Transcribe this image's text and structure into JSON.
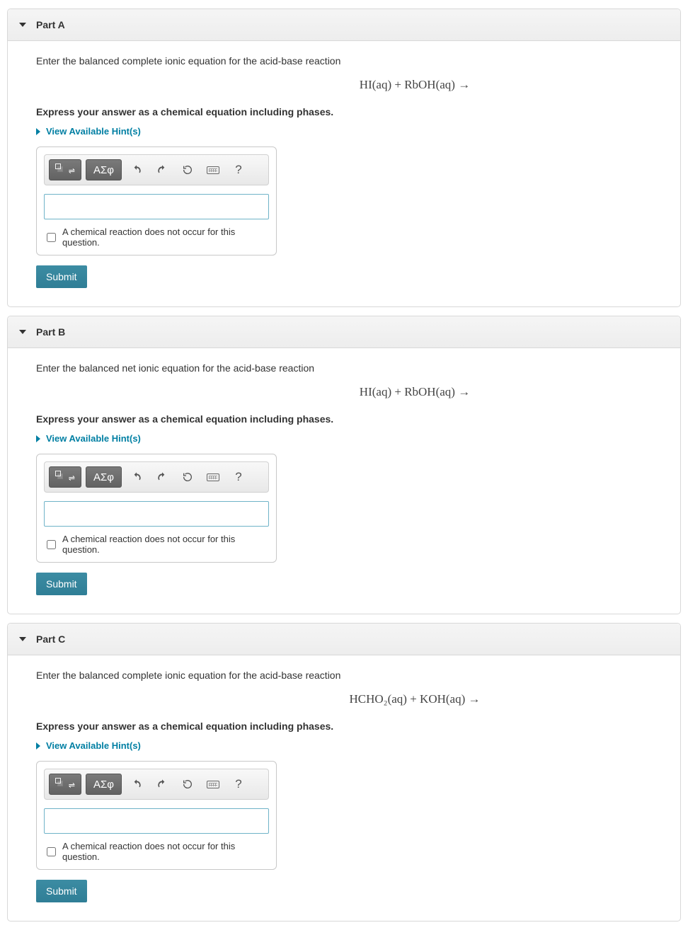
{
  "parts": [
    {
      "title": "Part A",
      "prompt": "Enter the balanced complete ionic equation for the acid-base reaction",
      "equation_html": "HI(aq) + RbOH(aq) →",
      "instruction": "Express your answer as a chemical equation including phases.",
      "hints_label": "View Available Hint(s)",
      "greek_label": "ΑΣφ",
      "help_char": "?",
      "answer_value": "",
      "checkbox_label": "A chemical reaction does not occur for this question.",
      "submit_label": "Submit"
    },
    {
      "title": "Part B",
      "prompt": "Enter the balanced net ionic equation for the acid-base reaction",
      "equation_html": "HI(aq)  +  RbOH(aq) →",
      "instruction": "Express your answer as a chemical equation including phases.",
      "hints_label": "View Available Hint(s)",
      "greek_label": "ΑΣφ",
      "help_char": "?",
      "answer_value": "",
      "checkbox_label": "A chemical reaction does not occur for this question.",
      "submit_label": "Submit"
    },
    {
      "title": "Part C",
      "prompt": "Enter the balanced complete ionic equation for the acid-base reaction",
      "equation_html": "HCHO₂(aq)  +  KOH(aq) →",
      "instruction": "Express your answer as a chemical equation including phases.",
      "hints_label": "View Available Hint(s)",
      "greek_label": "ΑΣφ",
      "help_char": "?",
      "answer_value": "",
      "checkbox_label": "A chemical reaction does not occur for this question.",
      "submit_label": "Submit"
    }
  ]
}
